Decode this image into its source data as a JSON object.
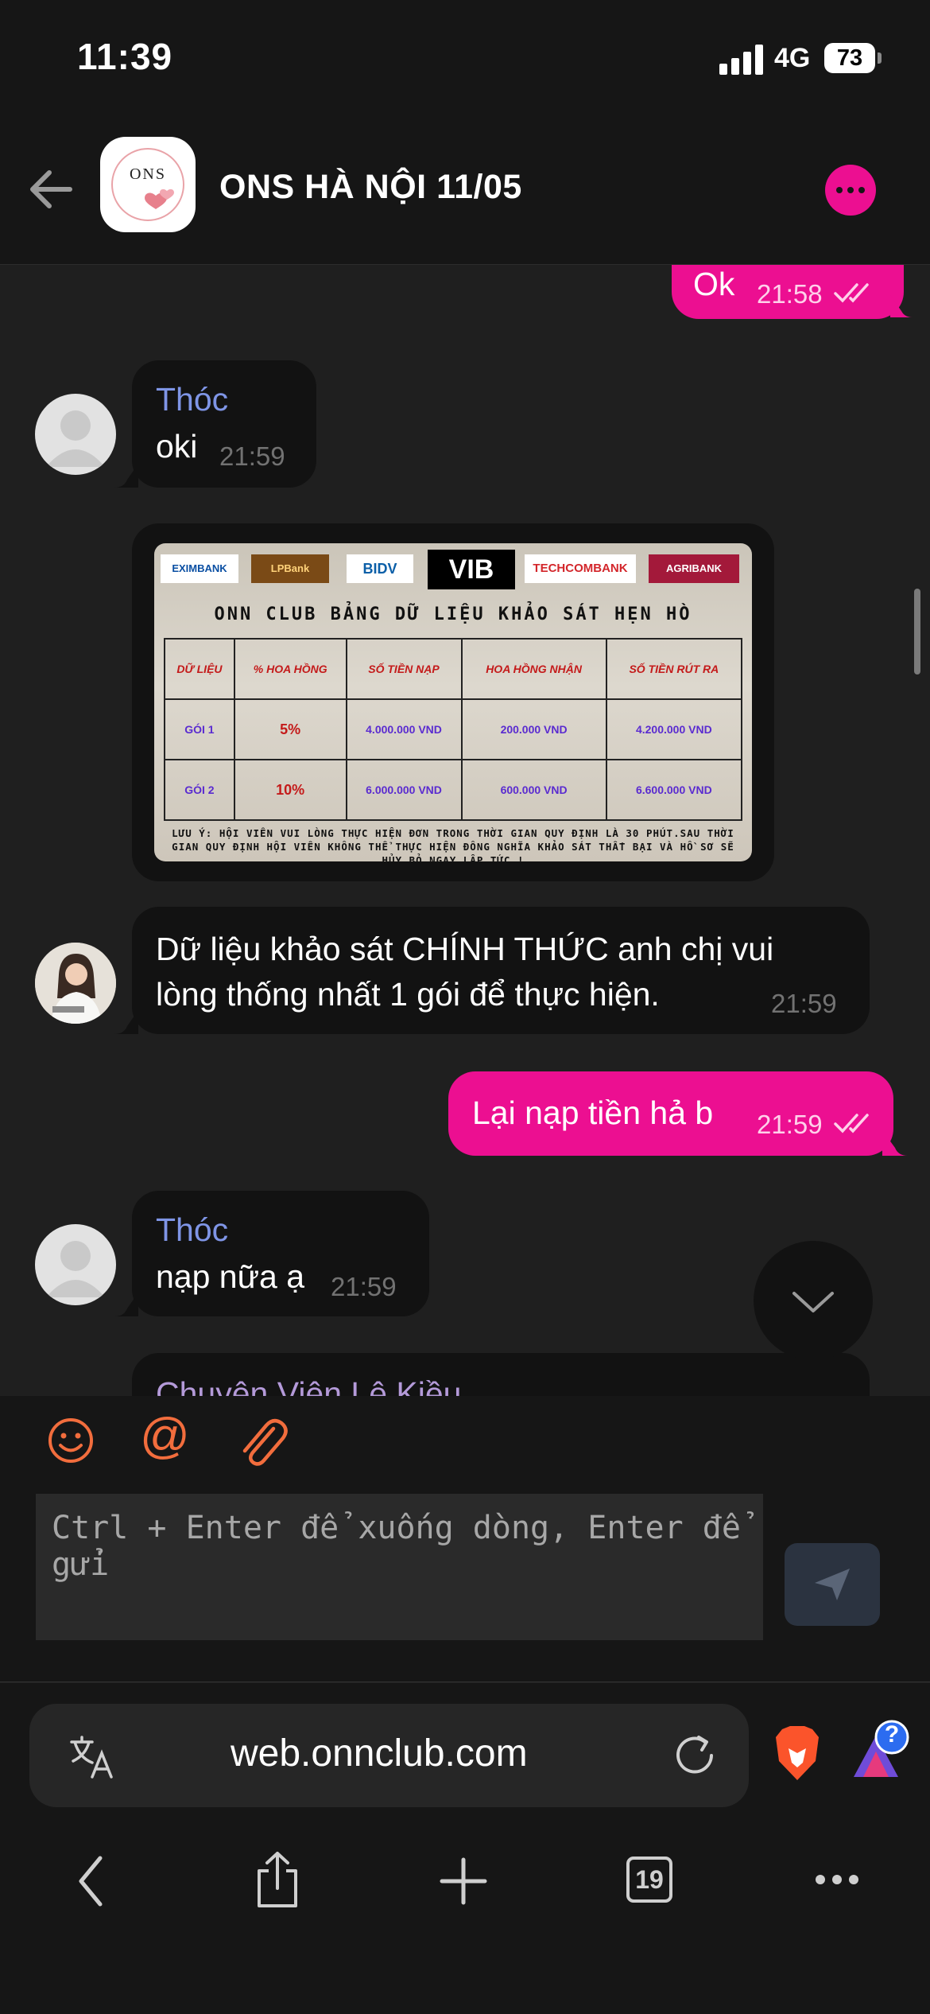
{
  "status": {
    "time": "11:39",
    "network": "4G",
    "battery": "73"
  },
  "header": {
    "title": "ONS HÀ NỘI 11/05",
    "avatar_text": "ONS"
  },
  "messages": {
    "m1": {
      "text": "Ok",
      "time": "21:58"
    },
    "m2": {
      "sender": "Thóc",
      "text": "oki",
      "time": "21:59"
    },
    "m3": {
      "line1": "Dữ liệu khảo sát CHÍNH THỨC anh chị vui",
      "line2": "lòng thống nhất 1 gói để thực hiện.",
      "time": "21:59"
    },
    "m4": {
      "text": "Lại nạp tiền hả b",
      "time": "21:59"
    },
    "m5": {
      "sender": "Thóc",
      "text": "nạp nữa ạ",
      "time": "21:59"
    },
    "m6": {
      "sender": "Chuyên Viên Lê Kiều"
    }
  },
  "survey": {
    "banks": [
      "EXIMBANK",
      "LPBank",
      "BIDV",
      "VIB",
      "TECHCOMBANK",
      "AGRIBANK"
    ],
    "heading": "ONN CLUB BẢNG DỮ LIỆU KHẢO SÁT HẸN HÒ",
    "headers": [
      "DỮ LIỆU",
      "% HOA HỒNG",
      "SỐ TIỀN NẠP",
      "HOA HỒNG NHẬN",
      "SỐ TIỀN RÚT RA"
    ],
    "rows": [
      [
        "GÓI 1",
        "5%",
        "4.000.000 VND",
        "200.000 VND",
        "4.200.000 VND"
      ],
      [
        "GÓI 2",
        "10%",
        "6.000.000 VND",
        "600.000 VND",
        "6.600.000 VND"
      ]
    ],
    "note": "LƯU Ý: HỘI VIÊN VUI LÒNG THỰC HIỆN ĐƠN TRONG THỜI GIAN QUY ĐỊNH LÀ 30 PHÚT.SAU THỜI GIAN QUY ĐỊNH HỘI VIÊN KHÔNG THỂ THỰC HIỆN ĐÔNG NGHĨA KHẢO SÁT THẤT BẠI VÀ HỒ SƠ SẼ HỦY BỎ NGAY LẬP TỨC !"
  },
  "composer": {
    "placeholder": "Ctrl + Enter để xuống dòng, Enter để gửi",
    "mention_symbol": "@"
  },
  "browser": {
    "url": "web.onnclub.com",
    "tab_count": "19",
    "rewards_badge": "?"
  },
  "colors": {
    "accent": "#ec0f91",
    "sender_name": "#7f95e6",
    "icon_orange": "#f26d3d"
  },
  "icons": [
    "back-arrow-icon",
    "more-icon",
    "emoji-icon",
    "attach-icon",
    "send-icon",
    "translate-icon",
    "reload-icon",
    "brave-icon",
    "rewards-icon",
    "chevron-down-icon"
  ]
}
